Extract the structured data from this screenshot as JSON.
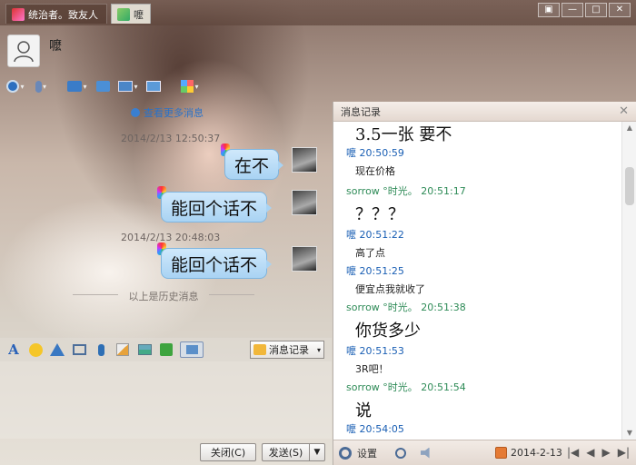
{
  "window": {
    "tabs": [
      {
        "label": "统治者。致友人"
      },
      {
        "label": "嚒"
      }
    ],
    "controls": [
      "▣",
      "—",
      "□",
      "✕"
    ]
  },
  "contact": {
    "name": "嚒"
  },
  "chat": {
    "more_link": "查看更多消息",
    "messages": [
      {
        "time": "2014/2/13 12:50:37",
        "text": "在不"
      },
      {
        "text": "能回个话不"
      },
      {
        "time": "2014/2/13 20:48:03",
        "text": "能回个话不"
      }
    ],
    "history_sep": "以上是历史消息"
  },
  "input_toolbar": {
    "records_btn": "消息记录"
  },
  "actions": {
    "close": "关闭(C)",
    "send": "发送(S)"
  },
  "records_panel": {
    "title": "消息记录",
    "entries": [
      {
        "kind": "big",
        "text": "3.5一张  要不"
      },
      {
        "kind": "me",
        "text": "嚒 20:50:59"
      },
      {
        "kind": "small",
        "text": "现在价格"
      },
      {
        "kind": "other",
        "text": "sorrow °时光。 20:51:17"
      },
      {
        "kind": "big",
        "text": "？？？"
      },
      {
        "kind": "me",
        "text": "嚒 20:51:22"
      },
      {
        "kind": "small",
        "text": "高了点"
      },
      {
        "kind": "me",
        "text": "嚒 20:51:25"
      },
      {
        "kind": "small",
        "text": "便宜点我就收了"
      },
      {
        "kind": "other",
        "text": "sorrow °时光。 20:51:38"
      },
      {
        "kind": "big",
        "text": "你货多少"
      },
      {
        "kind": "me",
        "text": "嚒 20:51:53"
      },
      {
        "kind": "small",
        "text": "3R吧！"
      },
      {
        "kind": "other",
        "text": "sorrow °时光。 20:51:54"
      },
      {
        "kind": "big",
        "text": "说"
      },
      {
        "kind": "me",
        "text": "嚒 20:54:05"
      }
    ],
    "footer": {
      "settings": "设置",
      "date": "2014-2-13"
    }
  }
}
